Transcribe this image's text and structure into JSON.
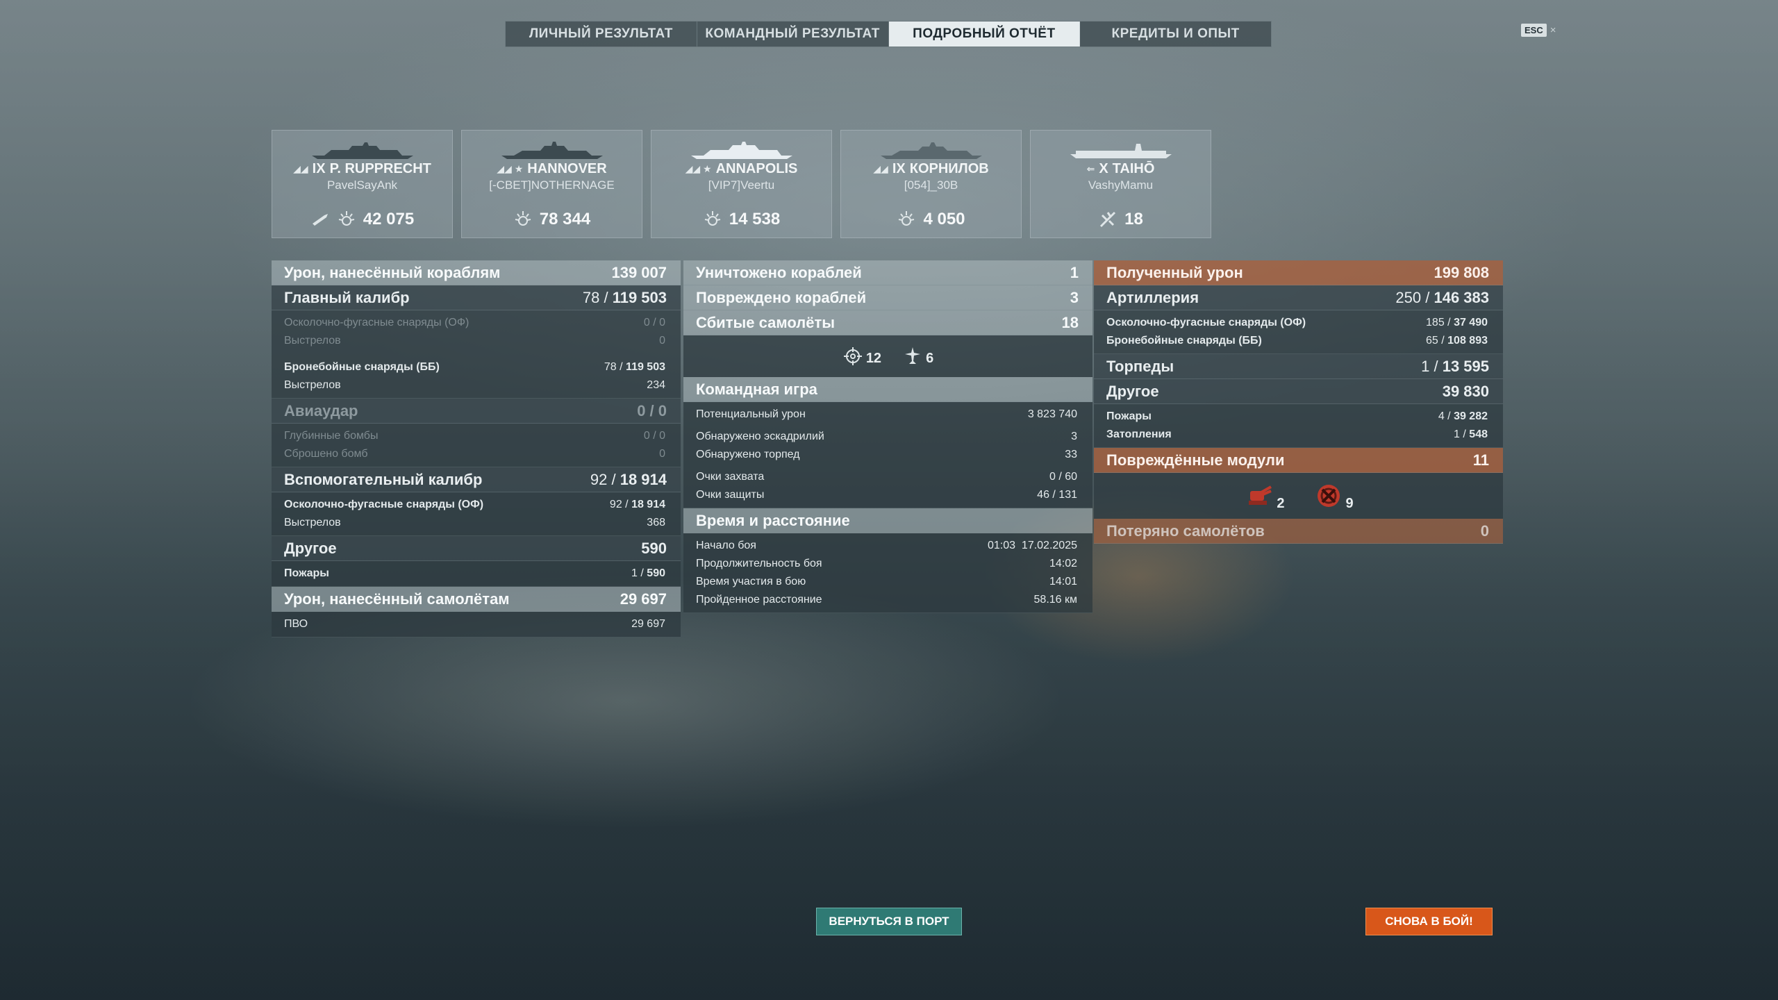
{
  "tabs": [
    {
      "label": "ЛИЧНЫЙ РЕЗУЛЬТАТ"
    },
    {
      "label": "КОМАНДНЫЙ РЕЗУЛЬТАТ"
    },
    {
      "label": "ПОДРОБНЫЙ ОТЧЁТ"
    },
    {
      "label": "КРЕДИТЫ И ОПЫТ"
    }
  ],
  "active_tab": "ПОДРОБНЫЙ ОТЧЁТ",
  "esc": {
    "key": "ESC",
    "close": "×"
  },
  "cards": [
    {
      "tier": "IX",
      "name": "P. RUPPRECHT",
      "player": "PavelSayAnk",
      "stat": "42 075",
      "icon": "damage-icon",
      "extra_icon": "torpedo-icon"
    },
    {
      "tier": "",
      "name": "HANNOVER",
      "player": "[-СВЕТ]NOTHERNAGE",
      "stat": "78 344",
      "icon": "damage-icon"
    },
    {
      "tier": "",
      "name": "ANNAPOLIS",
      "player": "[VIP7]Veertu",
      "stat": "14 538",
      "icon": "damage-icon"
    },
    {
      "tier": "IX",
      "name": "КОРНИЛОВ",
      "player": "[054]_30В",
      "stat": "4 050",
      "icon": "damage-icon"
    },
    {
      "tier": "X",
      "name": "TAIHŌ",
      "player": "VashyMamu",
      "stat": "18",
      "icon": "plane-shot-icon"
    }
  ],
  "left": {
    "ship_damage": {
      "label": "Урон, нанесённый кораблям",
      "value": "139 007"
    },
    "main_battery": {
      "label": "Главный калибр",
      "hits": "78",
      "value": "119 503"
    },
    "he_main": {
      "label": "Осколочно-фугасные снаряды (ОФ)",
      "value": "0 / 0"
    },
    "he_main_shots": {
      "label": "Выстрелов",
      "value": "0"
    },
    "ap_main": {
      "label": "Бронебойные снаряды (ББ)",
      "hits": "78",
      "value": "119 503"
    },
    "ap_main_shots": {
      "label": "Выстрелов",
      "value": "234"
    },
    "airstrike": {
      "label": "Авиаудар",
      "value": "0 / 0"
    },
    "depth_bombs": {
      "label": "Глубинные бомбы",
      "value": "0 / 0"
    },
    "bombs_dropped": {
      "label": "Сброшено бомб",
      "value": "0"
    },
    "secondary": {
      "label": "Вспомогательный калибр",
      "hits": "92",
      "value": "18 914"
    },
    "he_secondary": {
      "label": "Осколочно-фугасные снаряды (ОФ)",
      "hits": "92",
      "value": "18 914"
    },
    "he_secondary_shots": {
      "label": "Выстрелов",
      "value": "368"
    },
    "other": {
      "label": "Другое",
      "value": "590"
    },
    "fires": {
      "label": "Пожары",
      "hits": "1",
      "value": "590"
    },
    "plane_damage": {
      "label": "Урон, нанесённый самолётам",
      "value": "29 697"
    },
    "aa": {
      "label": "ПВО",
      "value": "29 697"
    }
  },
  "middle": {
    "destroyed": {
      "label": "Уничтожено кораблей",
      "value": "1"
    },
    "damaged": {
      "label": "Повреждено кораблей",
      "value": "3"
    },
    "planes_shot": {
      "label": "Сбитые самолёты",
      "value": "18"
    },
    "planes_icons": [
      {
        "icon": "crosshair-icon",
        "value": "12"
      },
      {
        "icon": "fighter-icon",
        "value": "6"
      }
    ],
    "teamplay": {
      "label": "Командная игра"
    },
    "potential": {
      "label": "Потенциальный урон",
      "value": "3 823 740"
    },
    "squadrons": {
      "label": "Обнаружено эскадрилий",
      "value": "3"
    },
    "torps": {
      "label": "Обнаружено торпед",
      "value": "33"
    },
    "capture": {
      "label": "Очки захвата",
      "value": "0 / 60"
    },
    "defense": {
      "label": "Очки защиты",
      "value": "46 / 131"
    },
    "time": {
      "label": "Время и расстояние"
    },
    "start": {
      "label": "Начало боя",
      "value": "01:03  17.02.2025"
    },
    "duration": {
      "label": "Продолжительность боя",
      "value": "14:02"
    },
    "participation": {
      "label": "Время участия в бою",
      "value": "14:01"
    },
    "distance": {
      "label": "Пройденное расстояние",
      "value": "58.16 км"
    }
  },
  "right": {
    "received": {
      "label": "Полученный урон",
      "value": "199 808"
    },
    "artillery": {
      "label": "Артиллерия",
      "hits": "250",
      "value": "146 383"
    },
    "he_recv": {
      "label": "Осколочно-фугасные снаряды (ОФ)",
      "hits": "185",
      "value": "37 490"
    },
    "ap_recv": {
      "label": "Бронебойные снаряды (ББ)",
      "hits": "65",
      "value": "108 893"
    },
    "torpedoes": {
      "label": "Торпеды",
      "hits": "1",
      "value": "13 595"
    },
    "other": {
      "label": "Другое",
      "value": "39 830"
    },
    "fires": {
      "label": "Пожары",
      "hits": "4",
      "value": "39 282"
    },
    "flooding": {
      "label": "Затопления",
      "hits": "1",
      "value": "548"
    },
    "modules": {
      "label": "Повреждённые модули",
      "value": "11"
    },
    "module_icons": [
      {
        "icon": "turret-damaged-icon",
        "value": "2"
      },
      {
        "icon": "engine-damaged-icon",
        "value": "9"
      }
    ],
    "lost_planes": {
      "label": "Потеряно самолётов",
      "value": "0"
    }
  },
  "buttons": {
    "port": "ВЕРНУТЬСЯ В ПОРТ",
    "battle": "СНОВА В БОЙ!"
  },
  "colors": {
    "accent_orange": "#d8571a",
    "port_green": "#2f7a74",
    "received_orange": "#aa603c"
  }
}
